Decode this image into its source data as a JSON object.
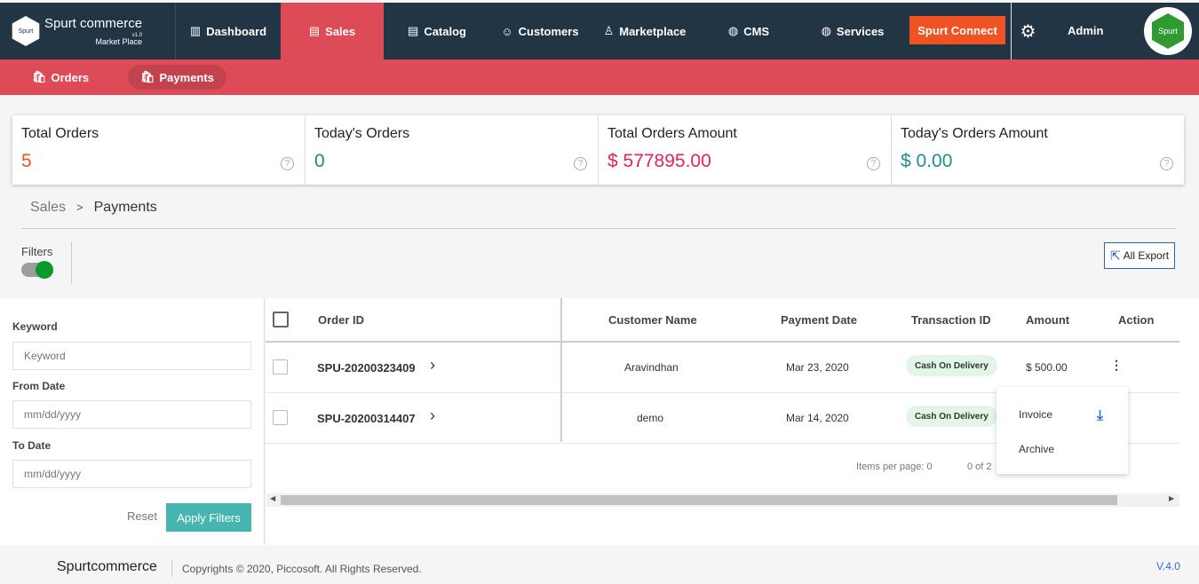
{
  "header": {
    "brand": "Spurt commerce",
    "brand_version": "v1.0",
    "brand_sub": "Market Place",
    "logo_text": "Spurt",
    "nav": [
      {
        "label": "Dashboard",
        "icon": "chart-icon"
      },
      {
        "label": "Sales",
        "icon": "clipboard-icon"
      },
      {
        "label": "Catalog",
        "icon": "catalog-icon"
      },
      {
        "label": "Customers",
        "icon": "customers-icon"
      },
      {
        "label": "Marketplace",
        "icon": "user-icon"
      },
      {
        "label": "CMS",
        "icon": "globe-icon"
      },
      {
        "label": "Services",
        "icon": "globe-icon"
      }
    ],
    "connect_label": "Spurt Connect",
    "admin_label": "Admin",
    "avatar_text": "Spurt",
    "accent": "#dd4b57",
    "navbar_color": "#223545"
  },
  "subnav": [
    {
      "label": "Orders"
    },
    {
      "label": "Payments"
    }
  ],
  "stats": [
    {
      "label": "Total Orders",
      "value": "5",
      "color": "#ef5223"
    },
    {
      "label": "Today's Orders",
      "value": "0",
      "color": "#1a9a3a"
    },
    {
      "label": "Total Orders Amount",
      "value": "$ 577895.00",
      "color": "#e0245e"
    },
    {
      "label": "Today's Orders Amount",
      "value": "$ 0.00",
      "color": "#1f8f8a"
    }
  ],
  "breadcrumb": {
    "parent": "Sales",
    "sep": ">",
    "current": "Payments"
  },
  "filters": {
    "toggle_label": "Filters",
    "keyword_label": "Keyword",
    "keyword_placeholder": "Keyword",
    "from_label": "From Date",
    "from_placeholder": "mm/dd/yyyy",
    "to_label": "To Date",
    "to_placeholder": "mm/dd/yyyy",
    "reset_label": "Reset",
    "apply_label": "Apply Filters"
  },
  "export_label": "All Export",
  "table": {
    "columns": [
      "Order ID",
      "Customer Name",
      "Payment Date",
      "Transaction ID",
      "Amount",
      "Action"
    ],
    "rows": [
      {
        "order_id": "SPU-20200323409",
        "customer": "Aravindhan",
        "date": "Mar 23, 2020",
        "transaction": "Cash On Delivery",
        "amount": "$ 500.00"
      },
      {
        "order_id": "SPU-20200314407",
        "customer": "demo",
        "date": "Mar 14, 2020",
        "transaction": "Cash On Delivery",
        "amount": ""
      }
    ],
    "items_per_page": "Items per page: 0",
    "range": "0 of 2"
  },
  "action_menu": {
    "invoice": "Invoice",
    "archive": "Archive"
  },
  "footer": {
    "brand": "Spurtcommerce",
    "copyright": "Copyrights © 2020, Piccosoft. All Rights Reserved.",
    "version": "V.4.0"
  }
}
